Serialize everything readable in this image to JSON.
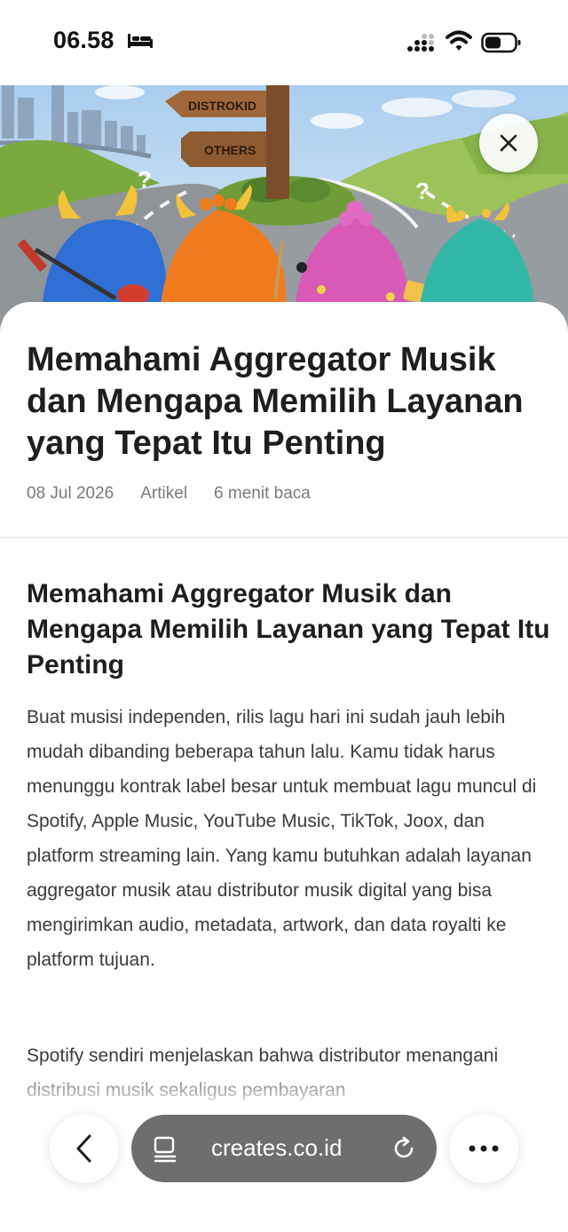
{
  "status_bar": {
    "time": "06.58",
    "icons": [
      "bed-icon",
      "cellular-signal-icon",
      "wifi-icon",
      "battery-icon"
    ]
  },
  "hero": {
    "signpost_labels": [
      "DISTROKID",
      "OTHERS"
    ],
    "question_marks": [
      "?",
      "?"
    ],
    "close_icon": "close-icon"
  },
  "article": {
    "title": "Memahami Aggregator Musik dan Mengapa Memilih Layanan yang Tepat Itu Penting",
    "meta": {
      "date": "08 Jul 2026",
      "category": "Artikel",
      "read_time": "6 menit baca"
    },
    "section_heading": "Memahami Aggregator Musik dan Mengapa Memilih Layanan yang Tepat Itu Penting",
    "paragraphs": [
      "Buat musisi independen, rilis lagu hari ini sudah jauh lebih mudah dibanding beberapa tahun lalu. Kamu tidak harus menunggu kontrak label besar untuk membuat lagu muncul di Spotify, Apple Music, YouTube Music, TikTok, Joox, dan platform streaming lain. Yang kamu butuhkan adalah layanan aggregator musik atau distributor musik digital yang bisa mengirimkan audio, metadata, artwork, dan data royalti ke platform tujuan.",
      "Spotify sendiri menjelaskan bahwa distributor menangani distribusi musik sekaligus pembayaran"
    ]
  },
  "toolbar": {
    "url": "creates.co.id",
    "icons": [
      "back-icon",
      "page-icon",
      "reload-icon",
      "more-icon"
    ]
  },
  "colors": {
    "url_pill": "#6e6e6e",
    "sky": "#bcd8f0",
    "monster_blue": "#2f6fd6",
    "monster_orange": "#f07b1e",
    "monster_pink": "#d95ab6",
    "monster_teal": "#33b7a6"
  }
}
